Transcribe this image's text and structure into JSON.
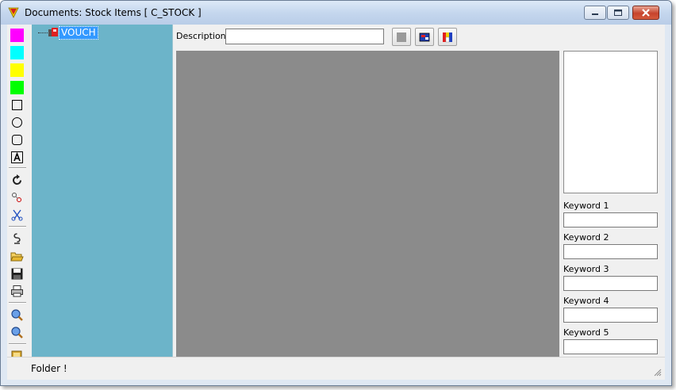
{
  "window": {
    "title": "Documents: Stock Items [ C_STOCK ]",
    "controls": {
      "minimize": "minimize-icon",
      "maximize": "maximize-icon",
      "close": "close-icon"
    },
    "close_color": "#c6432c"
  },
  "toolbar": {
    "colors": [
      "#ff00ff",
      "#00ffff",
      "#ffff00",
      "#00ff00"
    ],
    "tools": [
      "rectangle-tool-icon",
      "ellipse-tool-icon",
      "rounded-rectangle-tool-icon",
      "text-tool-icon",
      "rotate-icon",
      "hotspot-link-icon",
      "cut-icon",
      "scan-icon",
      "open-folder-icon",
      "save-icon",
      "print-icon",
      "zoom-in-icon",
      "zoom-out-icon",
      "folder-icon"
    ]
  },
  "tree": {
    "background": "#6cb4c9",
    "items": [
      {
        "label": "VOUCH",
        "selected": true
      }
    ]
  },
  "description": {
    "label": "Description:",
    "value": ""
  },
  "actions": [
    "gray-square-icon",
    "flag-image-icon",
    "color-blocks-icon"
  ],
  "keywords": [
    {
      "label": "Keyword 1",
      "value": ""
    },
    {
      "label": "Keyword 2",
      "value": ""
    },
    {
      "label": "Keyword 3",
      "value": ""
    },
    {
      "label": "Keyword 4",
      "value": ""
    },
    {
      "label": "Keyword 5",
      "value": ""
    }
  ],
  "status": {
    "text": "Folder !"
  }
}
